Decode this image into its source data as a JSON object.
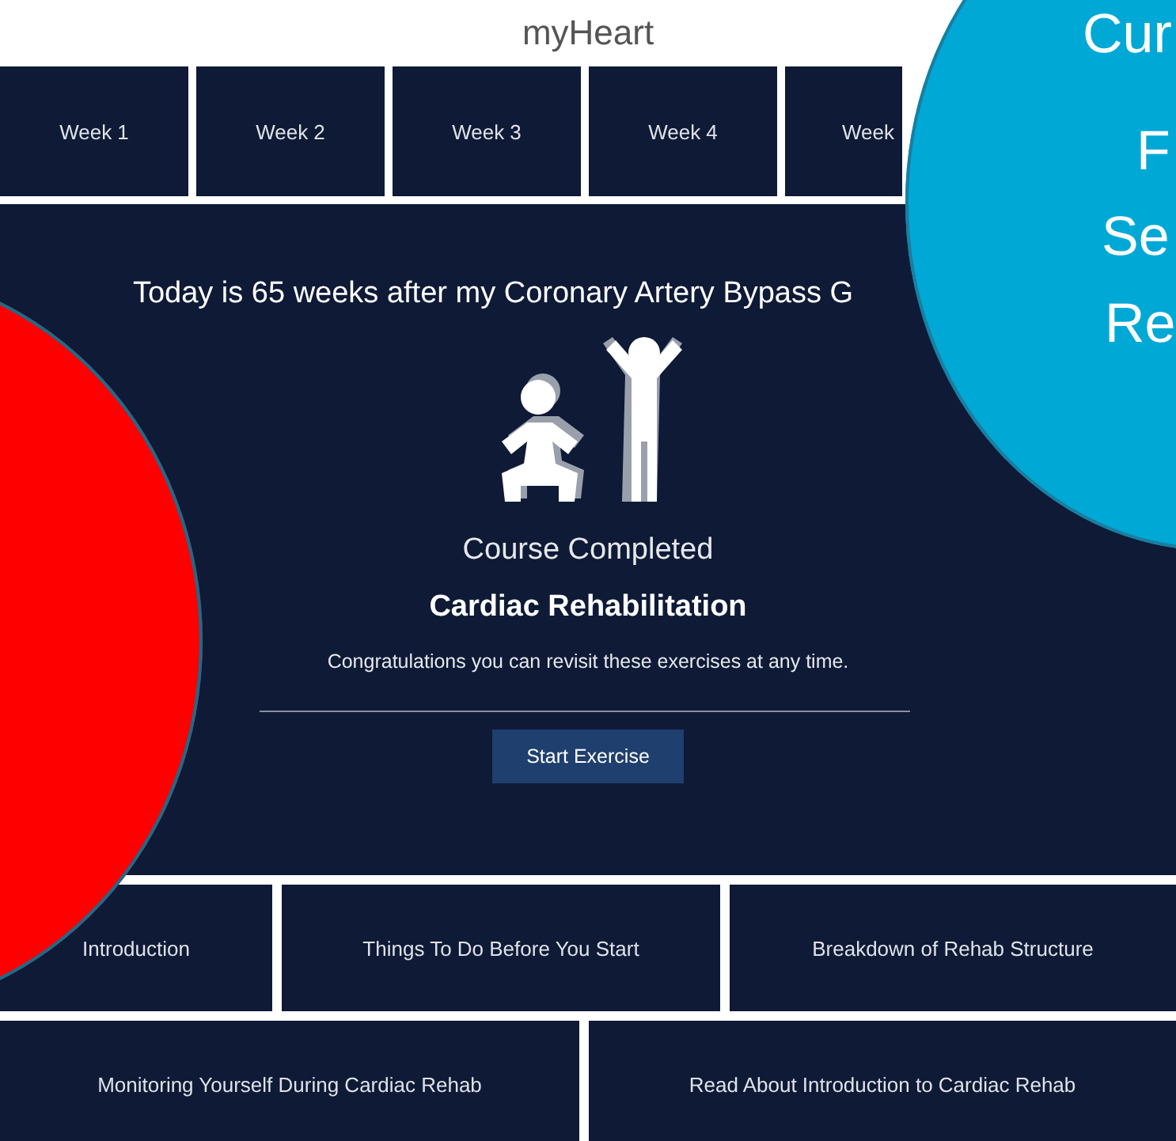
{
  "app_title": "myHeart",
  "weeks": [
    {
      "label": "Week 1"
    },
    {
      "label": "Week 2"
    },
    {
      "label": "Week 3"
    },
    {
      "label": "Week 4"
    },
    {
      "label": "Week"
    }
  ],
  "course": {
    "heading": "Today is 65 weeks after my Coronary Artery Bypass G",
    "status": "Course Completed",
    "name": "Cardiac Rehabilitation",
    "message": "Congratulations you can revisit these exercises at any time.",
    "button": "Start Exercise"
  },
  "modules": [
    {
      "label": "Introduction"
    },
    {
      "label": "Things To Do Before You Start"
    },
    {
      "label": "Breakdown of Rehab Structure"
    },
    {
      "label": "Monitoring Yourself During Cardiac Rehab"
    },
    {
      "label": "Read About Introduction to Cardiac Rehab"
    }
  ],
  "overlays": [
    {
      "kind": "circle",
      "color": "#ff0000"
    },
    {
      "kind": "callout",
      "color": "#00a8d6",
      "lines": [
        "Cur",
        "F",
        "Se",
        "Re"
      ]
    }
  ]
}
